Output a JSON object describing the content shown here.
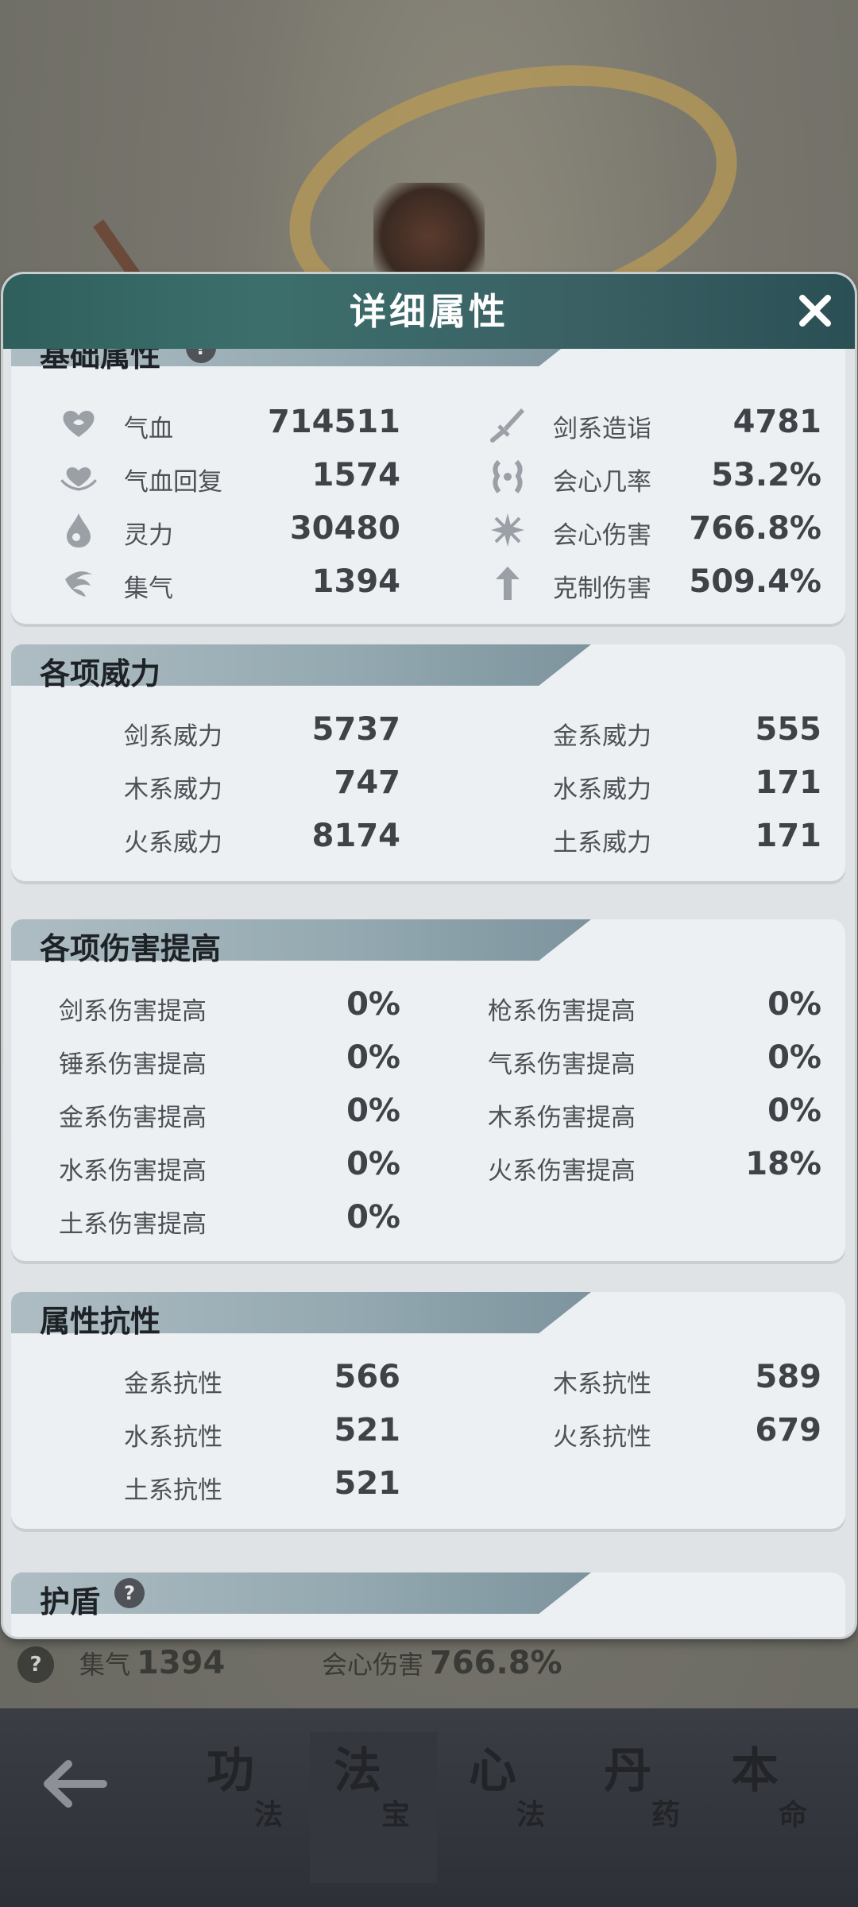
{
  "background": {
    "stat_bar": {
      "help_symbol": "?",
      "stat1_label": "集气",
      "stat1_value": "1394",
      "stat2_label": "会心伤害",
      "stat2_value": "766.8%"
    }
  },
  "dialog": {
    "title": "详细属性",
    "close_label": "X",
    "sections": {
      "basic": {
        "title": "基础属性",
        "help_symbol": "?",
        "left": [
          {
            "label": "气血",
            "value": "714511",
            "icon": "heart-icon"
          },
          {
            "label": "气血回复",
            "value": "1574",
            "icon": "heart-regen-icon"
          },
          {
            "label": "灵力",
            "value": "30480",
            "icon": "spirit-drop-icon"
          },
          {
            "label": "集气",
            "value": "1394",
            "icon": "swirl-icon"
          }
        ],
        "right": [
          {
            "label": "剑系造诣",
            "value": "4781",
            "icon": "sword-icon"
          },
          {
            "label": "会心几率",
            "value": "53.2%",
            "icon": "crit-rate-icon"
          },
          {
            "label": "会心伤害",
            "value": "766.8%",
            "icon": "crit-damage-icon"
          },
          {
            "label": "克制伤害",
            "value": "509.4%",
            "icon": "counter-arrow-icon"
          }
        ]
      },
      "power": {
        "title": "各项威力",
        "left": [
          {
            "label": "剑系威力",
            "value": "5737"
          },
          {
            "label": "木系威力",
            "value": "747"
          },
          {
            "label": "火系威力",
            "value": "8174"
          }
        ],
        "right": [
          {
            "label": "金系威力",
            "value": "555"
          },
          {
            "label": "水系威力",
            "value": "171"
          },
          {
            "label": "土系威力",
            "value": "171"
          }
        ]
      },
      "damage_boost": {
        "title": "各项伤害提高",
        "left": [
          {
            "label": "剑系伤害提高",
            "value": "0%"
          },
          {
            "label": "锤系伤害提高",
            "value": "0%"
          },
          {
            "label": "金系伤害提高",
            "value": "0%"
          },
          {
            "label": "水系伤害提高",
            "value": "0%"
          },
          {
            "label": "土系伤害提高",
            "value": "0%"
          }
        ],
        "right": [
          {
            "label": "枪系伤害提高",
            "value": "0%"
          },
          {
            "label": "气系伤害提高",
            "value": "0%"
          },
          {
            "label": "木系伤害提高",
            "value": "0%"
          },
          {
            "label": "火系伤害提高",
            "value": "18%"
          }
        ]
      },
      "resistance": {
        "title": "属性抗性",
        "left": [
          {
            "label": "金系抗性",
            "value": "566"
          },
          {
            "label": "水系抗性",
            "value": "521"
          },
          {
            "label": "土系抗性",
            "value": "521"
          }
        ],
        "right": [
          {
            "label": "木系抗性",
            "value": "589"
          },
          {
            "label": "火系抗性",
            "value": "679"
          }
        ]
      },
      "shield": {
        "title": "护盾",
        "help_symbol": "?"
      }
    }
  },
  "bottom_nav": {
    "tabs": [
      {
        "big": "功",
        "small": "法"
      },
      {
        "big": "法",
        "small": "宝",
        "active": true
      },
      {
        "big": "心",
        "small": "法"
      },
      {
        "big": "丹",
        "small": "药"
      },
      {
        "big": "本",
        "small": "命"
      }
    ]
  }
}
